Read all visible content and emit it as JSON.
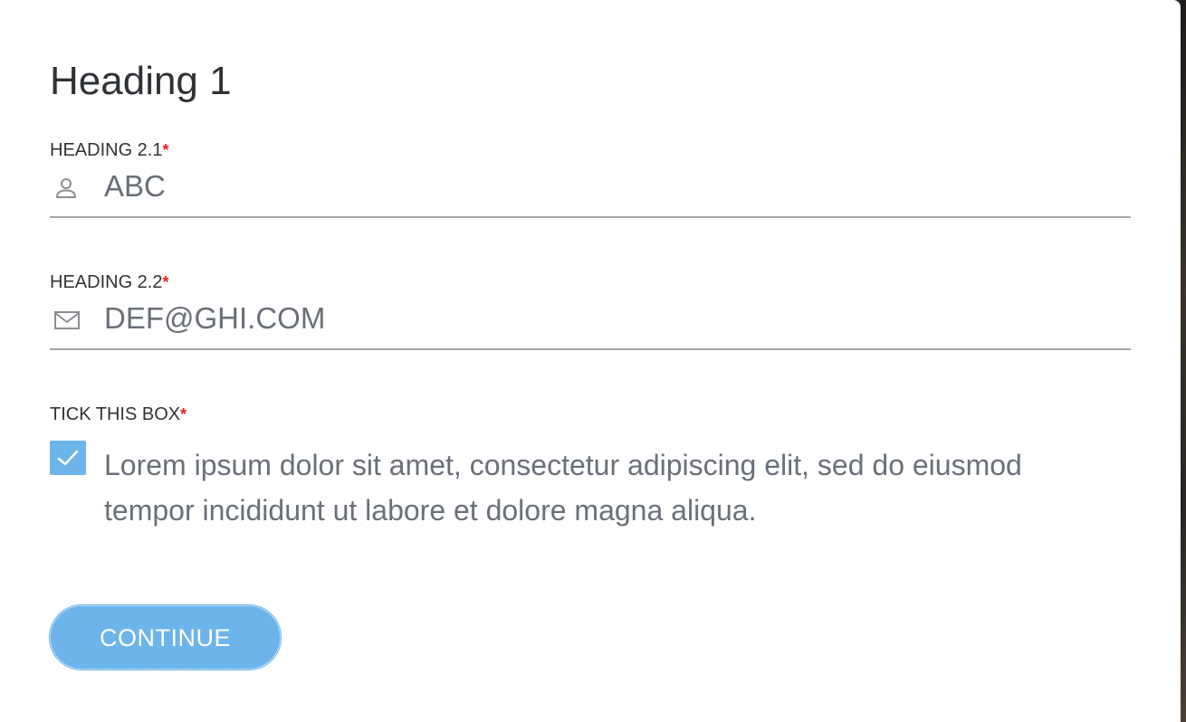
{
  "dialog": {
    "title": "Heading 1",
    "fields": [
      {
        "label": "HEADING 2.1",
        "required_marker": "*",
        "icon": "person-icon",
        "value": "ABC"
      },
      {
        "label": "HEADING 2.2",
        "required_marker": "*",
        "icon": "envelope-icon",
        "value": "DEF@GHI.COM"
      }
    ],
    "checkbox": {
      "label": "TICK THIS BOX",
      "required_marker": "*",
      "checked": true,
      "text": "Lorem ipsum dolor sit amet, consectetur adipiscing elit, sed do eiusmod tempor incididunt ut labore et dolore magna aliqua."
    },
    "continue_label": "CONTINUE"
  },
  "colors": {
    "accent": "#6cb4ea",
    "required": "#e4201f",
    "text_dark": "#2f3337",
    "text_muted": "#6a7079",
    "underline": "#a3a6a9"
  }
}
